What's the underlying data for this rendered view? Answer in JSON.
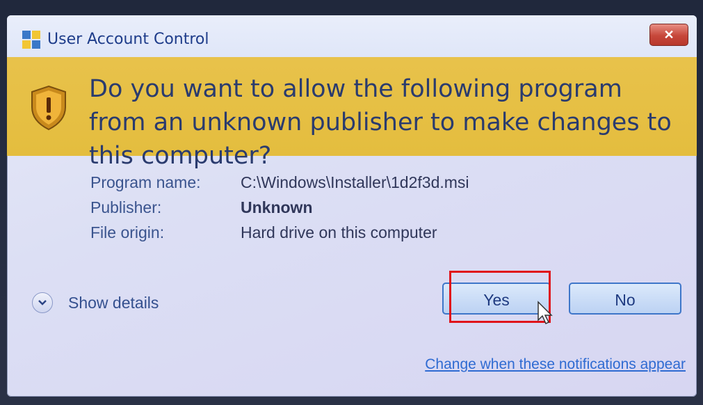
{
  "window": {
    "title": "User Account Control",
    "close_symbol": "✕"
  },
  "banner": {
    "question": "Do you want to allow the following program from an unknown publisher to make changes to this computer?",
    "icon": "shield-warning-icon"
  },
  "details": {
    "rows": [
      {
        "label": "Program name:",
        "value": "C:\\Windows\\Installer\\1d2f3d.msi",
        "bold": false
      },
      {
        "label": "Publisher:",
        "value": "Unknown",
        "bold": true
      },
      {
        "label": "File origin:",
        "value": "Hard drive on this computer",
        "bold": false
      }
    ]
  },
  "show_details": {
    "label": "Show details"
  },
  "buttons": {
    "yes": "Yes",
    "no": "No"
  },
  "link": {
    "text": "Change when these notifications appear"
  },
  "colors": {
    "banner": "#e4bd3e",
    "highlight": "#e0141b",
    "link": "#2f6bd2"
  }
}
